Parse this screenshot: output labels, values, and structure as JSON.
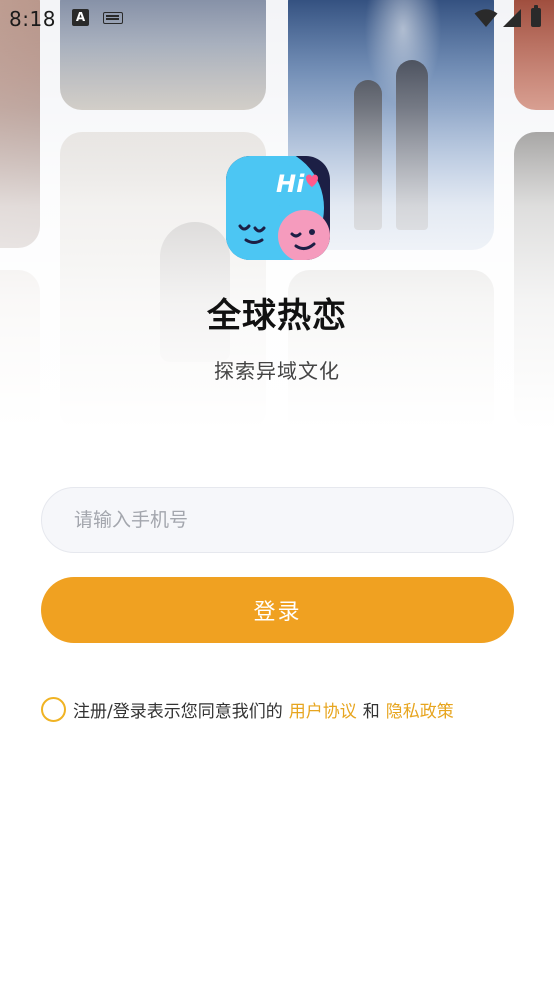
{
  "status_bar": {
    "time": "8:18",
    "icons": [
      "text-input-indicator-icon",
      "keyboard-icon",
      "wifi-icon",
      "cellular-signal-icon",
      "battery-icon"
    ]
  },
  "app": {
    "title": "全球热恋",
    "subtitle": "探索异域文化",
    "logo_text": "Hi"
  },
  "login_form": {
    "phone_placeholder": "请输入手机号",
    "phone_value": "",
    "login_label": "登录"
  },
  "agreement": {
    "checked": false,
    "prefix": "注册/登录表示您同意我们的",
    "user_agreement": "用户协议",
    "conjunction": "和",
    "privacy_policy": "隐私政策"
  },
  "colors": {
    "accent": "#f0a121",
    "link": "#e7a51f",
    "input_bg": "#f6f7fa",
    "logo_bg": "#1c1f45",
    "face_blue": "#4cc6f3",
    "face_pink": "#f59bbd",
    "heart": "#ff5a8c"
  }
}
